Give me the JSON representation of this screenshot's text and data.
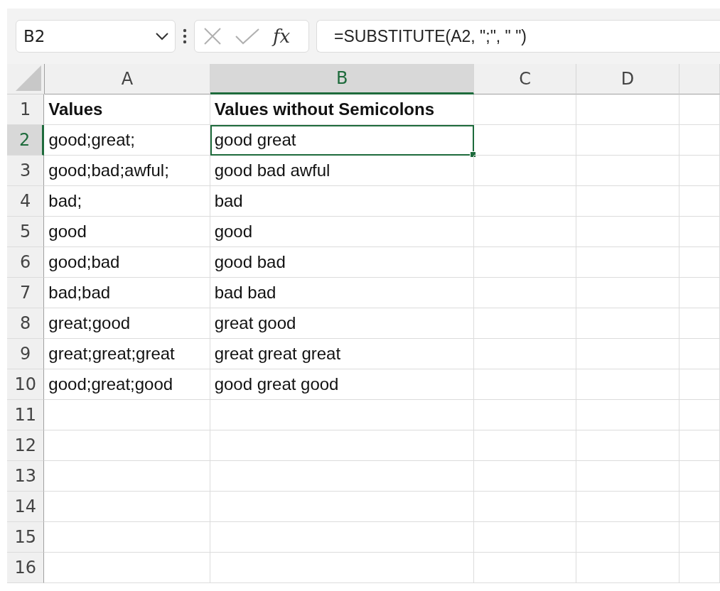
{
  "formula_bar": {
    "name_box": "B2",
    "function_label": "fx",
    "formula": "=SUBSTITUTE(A2, \";\", \" \")"
  },
  "columns": [
    {
      "label": "A",
      "selected": false
    },
    {
      "label": "B",
      "selected": true
    },
    {
      "label": "C",
      "selected": false
    },
    {
      "label": "D",
      "selected": false
    }
  ],
  "rows": [
    {
      "number": "1",
      "selected": false,
      "kind": "header",
      "cells": [
        "Values",
        "Values without Semicolons"
      ]
    },
    {
      "number": "2",
      "selected": true,
      "kind": "data",
      "cells": [
        "good;great;",
        "good great"
      ]
    },
    {
      "number": "3",
      "selected": false,
      "kind": "data",
      "cells": [
        "good;bad;awful;",
        "good bad awful"
      ]
    },
    {
      "number": "4",
      "selected": false,
      "kind": "data",
      "cells": [
        "bad;",
        "bad"
      ]
    },
    {
      "number": "5",
      "selected": false,
      "kind": "data",
      "cells": [
        "good",
        "good"
      ]
    },
    {
      "number": "6",
      "selected": false,
      "kind": "data",
      "cells": [
        "good;bad",
        "good bad"
      ]
    },
    {
      "number": "7",
      "selected": false,
      "kind": "data",
      "cells": [
        "bad;bad",
        "bad bad"
      ]
    },
    {
      "number": "8",
      "selected": false,
      "kind": "data",
      "cells": [
        "great;good",
        "great good"
      ]
    },
    {
      "number": "9",
      "selected": false,
      "kind": "data",
      "cells": [
        "great;great;great",
        "great great great"
      ]
    },
    {
      "number": "10",
      "selected": false,
      "kind": "data",
      "cells": [
        "good;great;good",
        "good great good"
      ]
    },
    {
      "number": "11",
      "selected": false,
      "kind": "data"
    },
    {
      "number": "12",
      "selected": false,
      "kind": "data"
    },
    {
      "number": "13",
      "selected": false,
      "kind": "data"
    },
    {
      "number": "14",
      "selected": false,
      "kind": "data"
    },
    {
      "number": "15",
      "selected": false,
      "kind": "data"
    },
    {
      "number": "16",
      "selected": false,
      "kind": "data"
    }
  ]
}
